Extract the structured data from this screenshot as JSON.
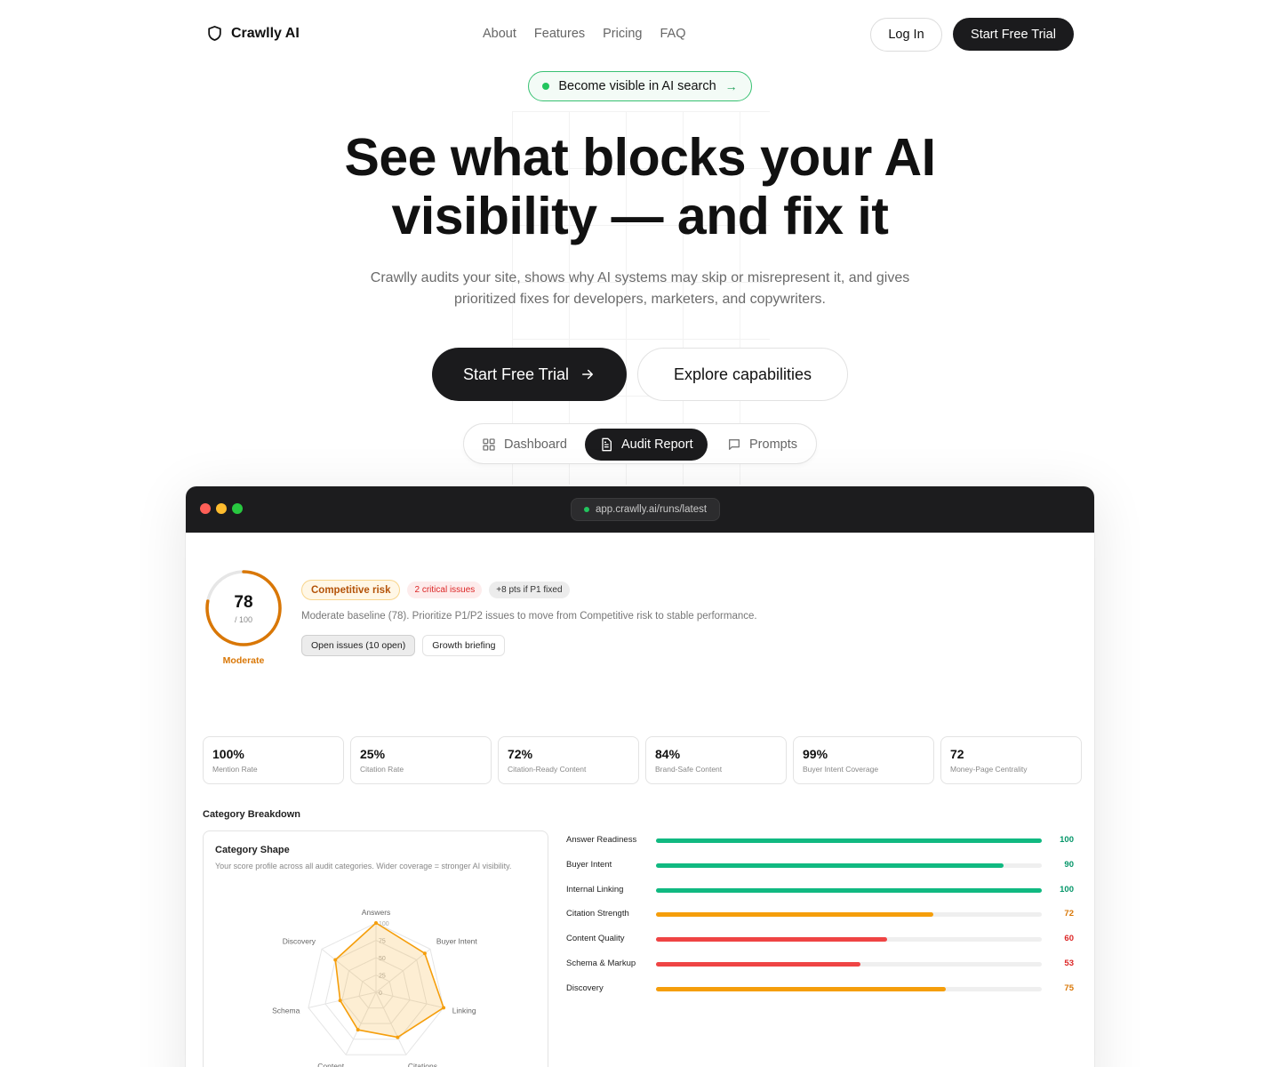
{
  "brand": {
    "name": "Crawlly AI",
    "icon": "shield-icon"
  },
  "nav": {
    "links": [
      "About",
      "Features",
      "Pricing",
      "FAQ"
    ],
    "login_label": "Log In",
    "trial_label": "Start Free Trial"
  },
  "hero": {
    "pill_text": "Become visible in AI search",
    "title_line1": "See what blocks your AI",
    "title_line2": "visibility — and fix it",
    "subtitle": "Crawlly audits your site, shows why AI systems may skip or misrepresent it, and gives prioritized fixes for developers, marketers, and copywriters.",
    "cta_primary": "Start Free Trial",
    "cta_secondary": "Explore capabilities"
  },
  "tabs": [
    {
      "label": "Dashboard",
      "icon": "dashboard-icon",
      "active": false
    },
    {
      "label": "Audit Report",
      "icon": "document-icon",
      "active": true
    },
    {
      "label": "Prompts",
      "icon": "chat-icon",
      "active": false
    }
  ],
  "window": {
    "url": "app.crawlly.ai/runs/latest",
    "traffic_colors": [
      "#ff5f57",
      "#febc2e",
      "#28c840"
    ]
  },
  "report": {
    "score": "78",
    "score_max": "/ 100",
    "score_value": 78,
    "score_label": "Moderate",
    "badge_risk": "Competitive risk",
    "badge_critical": "2 critical issues",
    "badge_points": "+8 pts if P1 fixed",
    "summary": "Moderate baseline (78). Prioritize P1/P2 issues to move from Competitive risk to stable performance.",
    "btn_issues": "Open issues (10 open)",
    "btn_briefing": "Growth briefing",
    "metrics": [
      {
        "value": "100%",
        "label": "Mention Rate"
      },
      {
        "value": "25%",
        "label": "Citation Rate"
      },
      {
        "value": "72%",
        "label": "Citation-Ready Content"
      },
      {
        "value": "84%",
        "label": "Brand-Safe Content"
      },
      {
        "value": "99%",
        "label": "Buyer Intent Coverage"
      },
      {
        "value": "72",
        "label": "Money-Page Centrality"
      }
    ],
    "section_title": "Category Breakdown",
    "radar": {
      "title": "Category Shape",
      "description": "Your score profile across all audit categories. Wider coverage = stronger AI visibility.",
      "axes": [
        "Answers",
        "Buyer Intent",
        "Linking",
        "Citations",
        "Content",
        "Schema",
        "Discovery"
      ],
      "values": [
        100,
        90,
        100,
        72,
        60,
        53,
        75
      ],
      "ticks": [
        "0",
        "25",
        "50",
        "75",
        "100"
      ],
      "color": "#f59e0b"
    },
    "categories": [
      {
        "label": "Answer Readiness",
        "value": 100,
        "color": "#10b981"
      },
      {
        "label": "Buyer Intent",
        "value": 90,
        "color": "#10b981"
      },
      {
        "label": "Internal Linking",
        "value": 100,
        "color": "#10b981"
      },
      {
        "label": "Citation Strength",
        "value": 72,
        "color": "#f59e0b"
      },
      {
        "label": "Content Quality",
        "value": 60,
        "color": "#ef4444"
      },
      {
        "label": "Schema & Markup",
        "value": 53,
        "color": "#ef4444"
      },
      {
        "label": "Discovery",
        "value": 75,
        "color": "#f59e0b"
      }
    ]
  }
}
